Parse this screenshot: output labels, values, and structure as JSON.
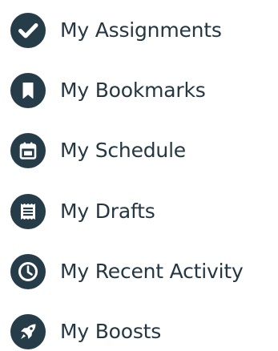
{
  "menu": {
    "items": [
      {
        "label": "My Assignments",
        "icon": "check-icon"
      },
      {
        "label": "My Bookmarks",
        "icon": "bookmark-icon"
      },
      {
        "label": "My Schedule",
        "icon": "calendar-icon"
      },
      {
        "label": "My Drafts",
        "icon": "drafts-icon"
      },
      {
        "label": "My Recent Activity",
        "icon": "clock-icon"
      },
      {
        "label": "My Boosts",
        "icon": "rocket-icon"
      }
    ]
  },
  "colors": {
    "icon_background": "#263c48",
    "label_text": "#243742",
    "icon_glyph": "#ffffff"
  }
}
